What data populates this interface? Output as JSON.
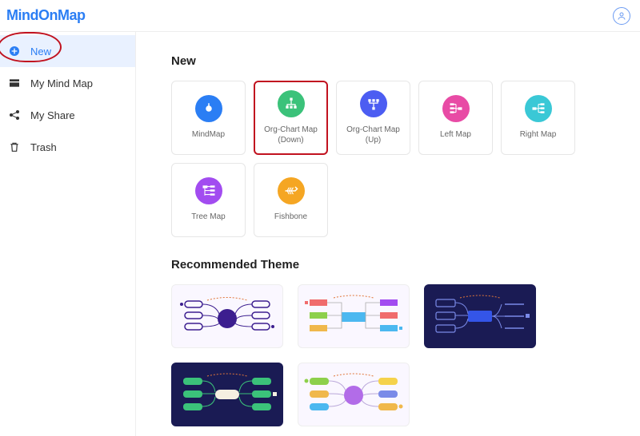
{
  "header": {
    "logo": "MindOnMap"
  },
  "sidebar": {
    "items": [
      {
        "label": "New",
        "active": true
      },
      {
        "label": "My Mind Map",
        "active": false
      },
      {
        "label": "My Share",
        "active": false
      },
      {
        "label": "Trash",
        "active": false
      }
    ]
  },
  "main": {
    "new_title": "New",
    "cards": [
      {
        "label": "MindMap",
        "color": "#2b7ef4"
      },
      {
        "label": "Org-Chart Map (Down)",
        "color": "#3bc27a"
      },
      {
        "label": "Org-Chart Map (Up)",
        "color": "#4c5df2"
      },
      {
        "label": "Left Map",
        "color": "#e84ba5"
      },
      {
        "label": "Right Map",
        "color": "#3ac8d6"
      },
      {
        "label": "Tree Map",
        "color": "#a24cf0"
      },
      {
        "label": "Fishbone",
        "color": "#f5a623"
      }
    ],
    "themes_title": "Recommended Theme"
  }
}
